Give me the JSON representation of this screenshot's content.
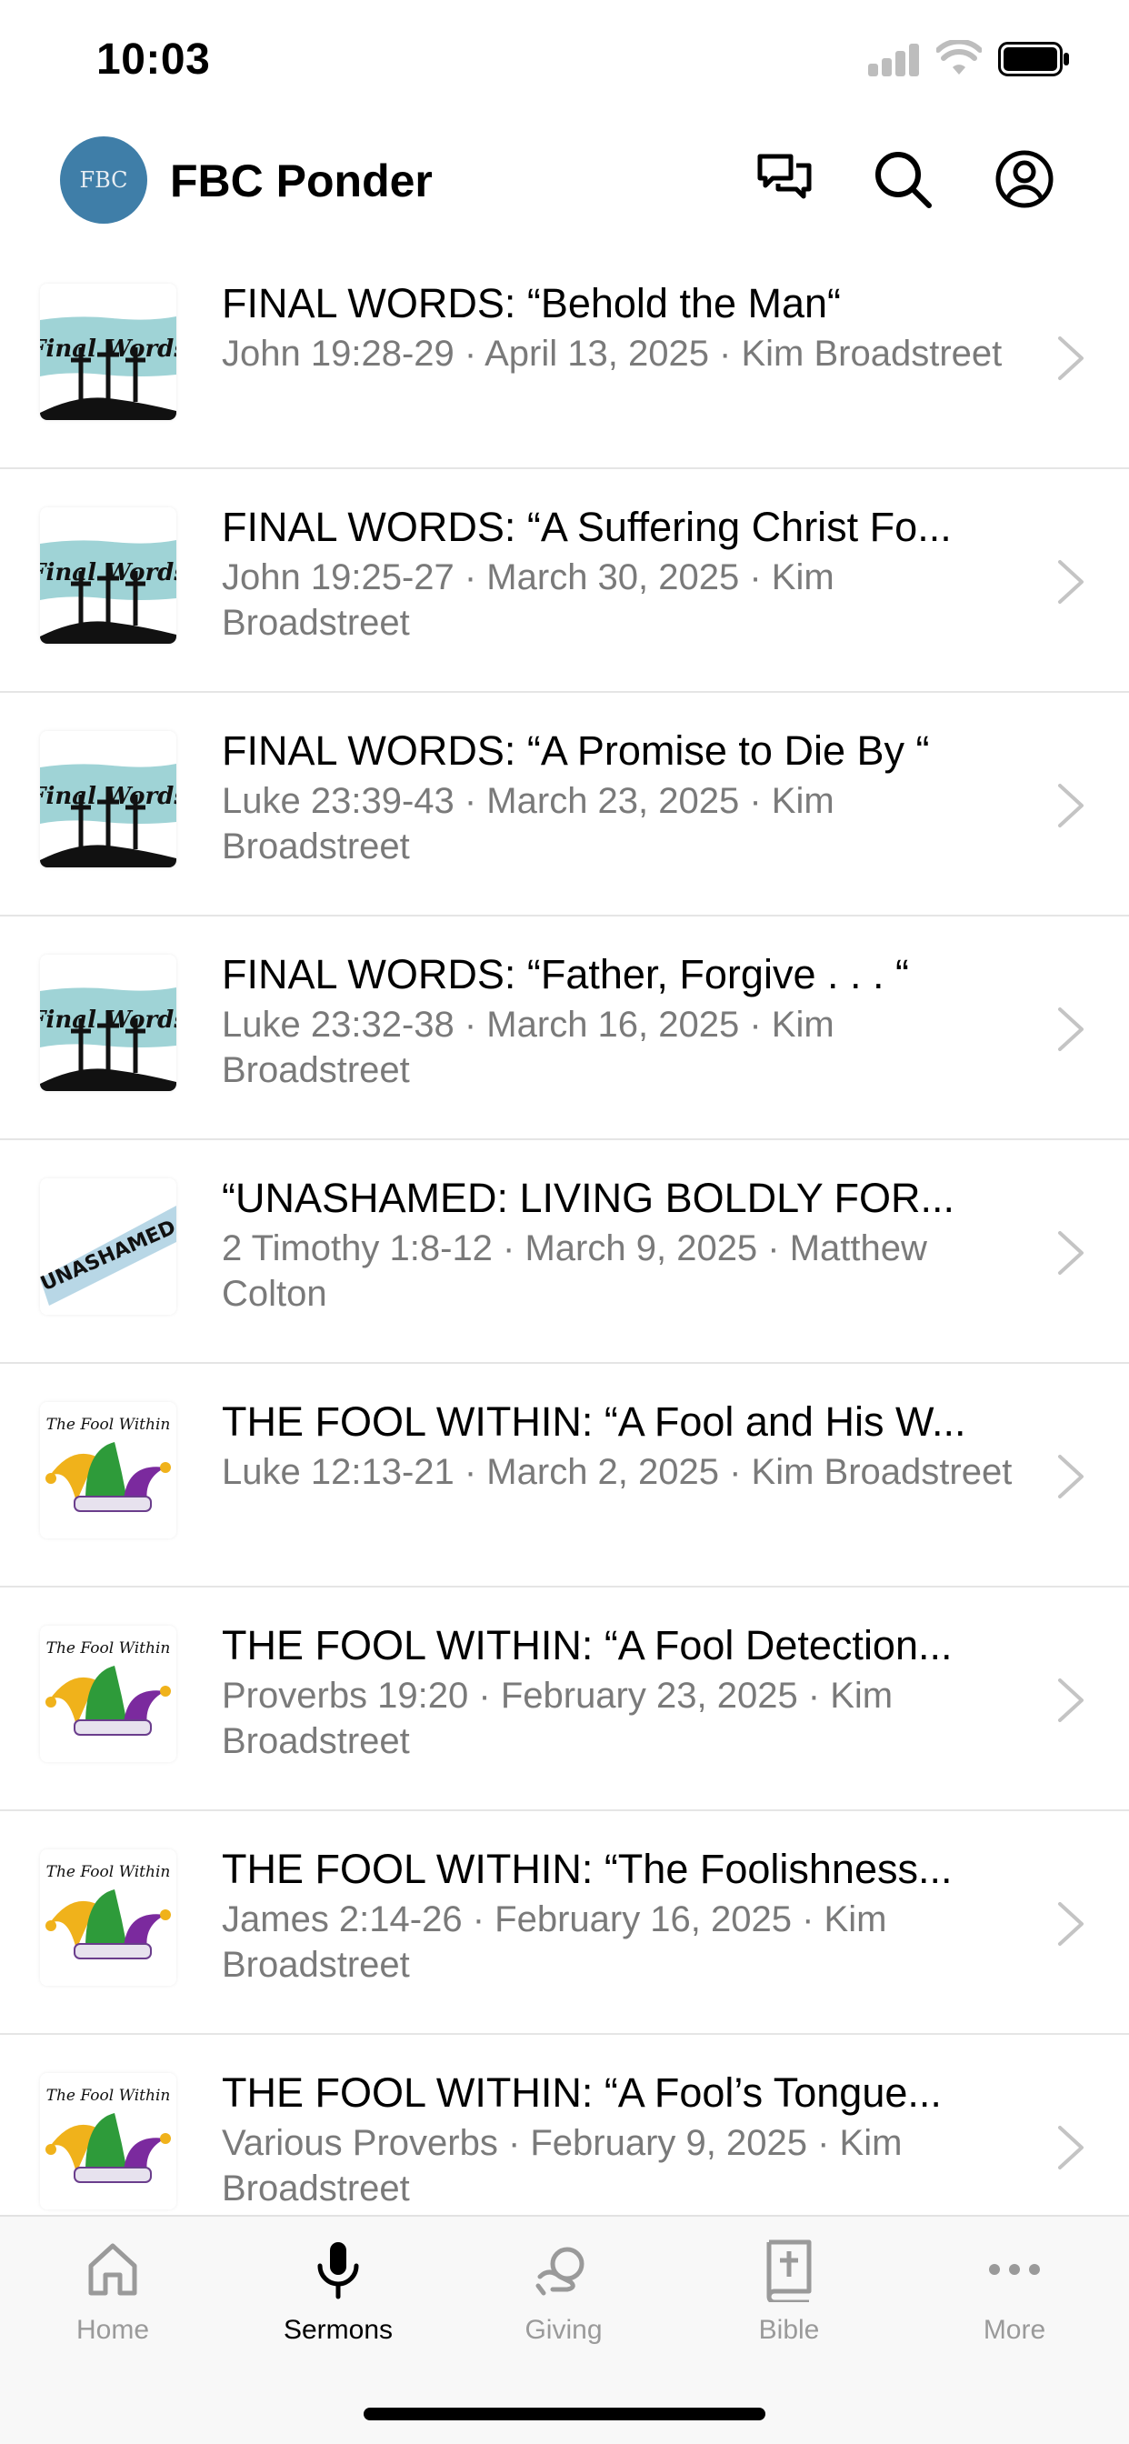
{
  "status_bar": {
    "time": "10:03"
  },
  "header": {
    "church_name": "FBC Ponder",
    "logo_text": "FBC"
  },
  "sermons": [
    {
      "title": "FINAL WORDS: “Behold the Man“",
      "meta": "John 19:28-29 · April 13, 2025 · Kim Broadstreet",
      "series_art": "Final Words"
    },
    {
      "title": "FINAL WORDS: “A Suffering Christ Fo...",
      "meta": "John 19:25-27 · March 30, 2025 · Kim Broadstreet",
      "series_art": "Final Words"
    },
    {
      "title": "FINAL WORDS: “A Promise to Die By “",
      "meta": "Luke 23:39-43 · March 23, 2025 · Kim Broadstreet",
      "series_art": "Final Words"
    },
    {
      "title": "FINAL WORDS: “Father, Forgive . . . “",
      "meta": "Luke 23:32-38 · March 16, 2025 · Kim Broadstreet",
      "series_art": "Final Words"
    },
    {
      "title": "“UNASHAMED: LIVING BOLDLY FOR...",
      "meta": "2 Timothy 1:8-12 · March 9, 2025 · Matthew Colton",
      "series_art": "UNASHAMED"
    },
    {
      "title": "THE FOOL WITHIN: “A Fool and His W...",
      "meta": "Luke 12:13-21 · March 2, 2025 · Kim Broadstreet",
      "series_art": "The Fool Within"
    },
    {
      "title": "THE FOOL WITHIN: “A Fool Detection...",
      "meta": "Proverbs 19:20 · February 23, 2025 · Kim Broadstreet",
      "series_art": "The Fool Within"
    },
    {
      "title": "THE FOOL WITHIN: “The Foolishness...",
      "meta": "James 2:14-26 · February 16, 2025 · Kim Broadstreet",
      "series_art": "The Fool Within"
    },
    {
      "title": "THE FOOL WITHIN: “A Fool’s Tongue...",
      "meta": "Various Proverbs · February 9, 2025 · Kim Broadstreet",
      "series_art": "The Fool Within"
    }
  ],
  "tabs": [
    {
      "label": "Home",
      "icon": "home-icon",
      "active": false
    },
    {
      "label": "Sermons",
      "icon": "microphone-icon",
      "active": true
    },
    {
      "label": "Giving",
      "icon": "giving-icon",
      "active": false
    },
    {
      "label": "Bible",
      "icon": "bible-icon",
      "active": false
    },
    {
      "label": "More",
      "icon": "more-icon",
      "active": false
    }
  ],
  "colors": {
    "accent_logo": "#3f7ea8",
    "teal_brush": "#9fd3d6",
    "inactive_gray": "#9a9a9a"
  }
}
